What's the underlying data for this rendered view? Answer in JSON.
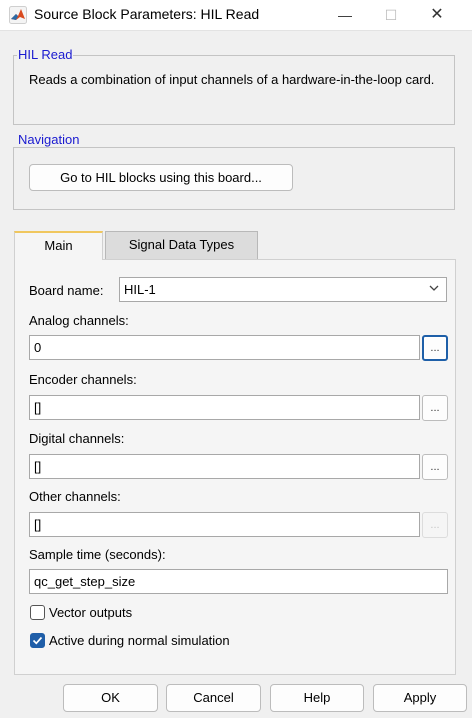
{
  "window": {
    "title": "Source Block Parameters: HIL Read",
    "minimize": "—",
    "maximize": "☐",
    "close": "✕"
  },
  "hil_read_group": {
    "title": "HIL Read",
    "description": "Reads a combination of input channels of a hardware-in-the-loop card."
  },
  "navigation_group": {
    "title": "Navigation",
    "goto_button": "Go to HIL blocks using this board..."
  },
  "tabs": [
    {
      "label": "Main",
      "active": true
    },
    {
      "label": "Signal Data Types",
      "active": false
    }
  ],
  "params": {
    "board_name_label": "Board name:",
    "board_name_value": "HIL-1",
    "analog_label": "Analog channels:",
    "analog_value": "0",
    "encoder_label": "Encoder channels:",
    "encoder_value": "[]",
    "digital_label": "Digital channels:",
    "digital_value": "[]",
    "other_label": "Other channels:",
    "other_value": "[]",
    "sample_time_label": "Sample time (seconds):",
    "sample_time_value": "qc_get_step_size",
    "browse": "...",
    "vector_outputs_label": "Vector outputs",
    "vector_outputs_checked": false,
    "active_sim_label": "Active during normal simulation",
    "active_sim_checked": true
  },
  "footer": {
    "ok": "OK",
    "cancel": "Cancel",
    "help": "Help",
    "apply": "Apply"
  },
  "colors": {
    "group_title": "#1a1ad0",
    "focus_blue": "#1e5fa8",
    "active_tab_accent": "#f0c75e"
  }
}
